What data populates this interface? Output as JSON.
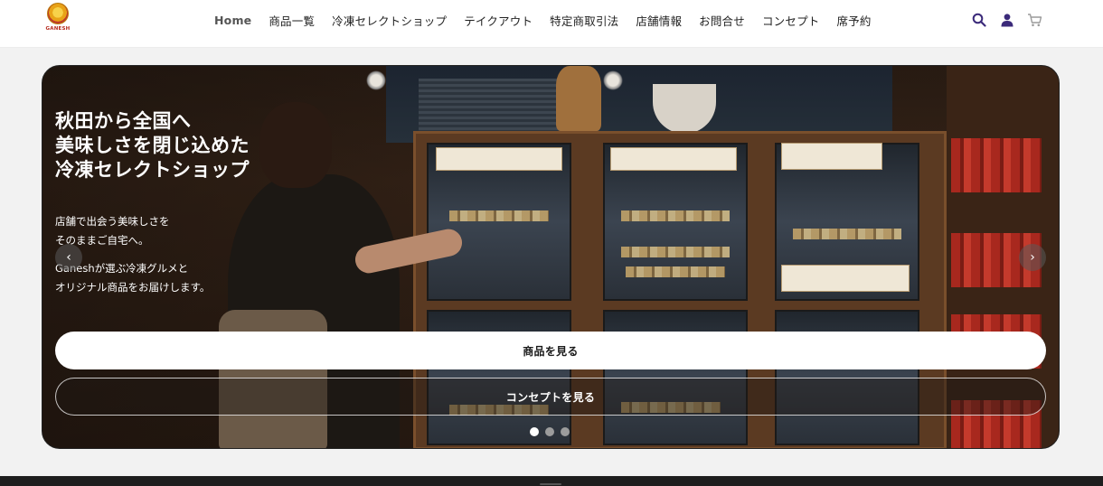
{
  "header": {
    "logo_text": "GANESH",
    "nav": [
      {
        "label": "Home",
        "active": true
      },
      {
        "label": "商品一覧"
      },
      {
        "label": "冷凍セレクトショップ"
      },
      {
        "label": "テイクアウト"
      },
      {
        "label": "特定商取引法"
      },
      {
        "label": "店舗情報"
      },
      {
        "label": "お問合せ"
      },
      {
        "label": "コンセプト"
      },
      {
        "label": "席予約"
      }
    ],
    "icons": [
      "search-icon",
      "account-icon",
      "cart-icon"
    ]
  },
  "hero": {
    "title_lines": [
      "秋田から全国へ",
      "美味しさを閉じ込めた",
      "冷凍セレクトショップ"
    ],
    "desc_lines_1": [
      "店舗で出会う美味しさを",
      "そのままご自宅へ。"
    ],
    "desc_lines_2": [
      "Ganeshが選ぶ冷凍グルメと",
      "オリジナル商品をお届けします。"
    ],
    "primary_button": "商品を見る",
    "secondary_button": "コンセプトを見る",
    "prev_arrow": "‹",
    "next_arrow": "›",
    "slides_total": 3,
    "slide_active": 1
  },
  "colors": {
    "header_bg": "#ffffff",
    "page_bg": "#f2f2f2",
    "icon_purple": "#3b2a7a",
    "footer_bg": "#1e1e1e"
  }
}
